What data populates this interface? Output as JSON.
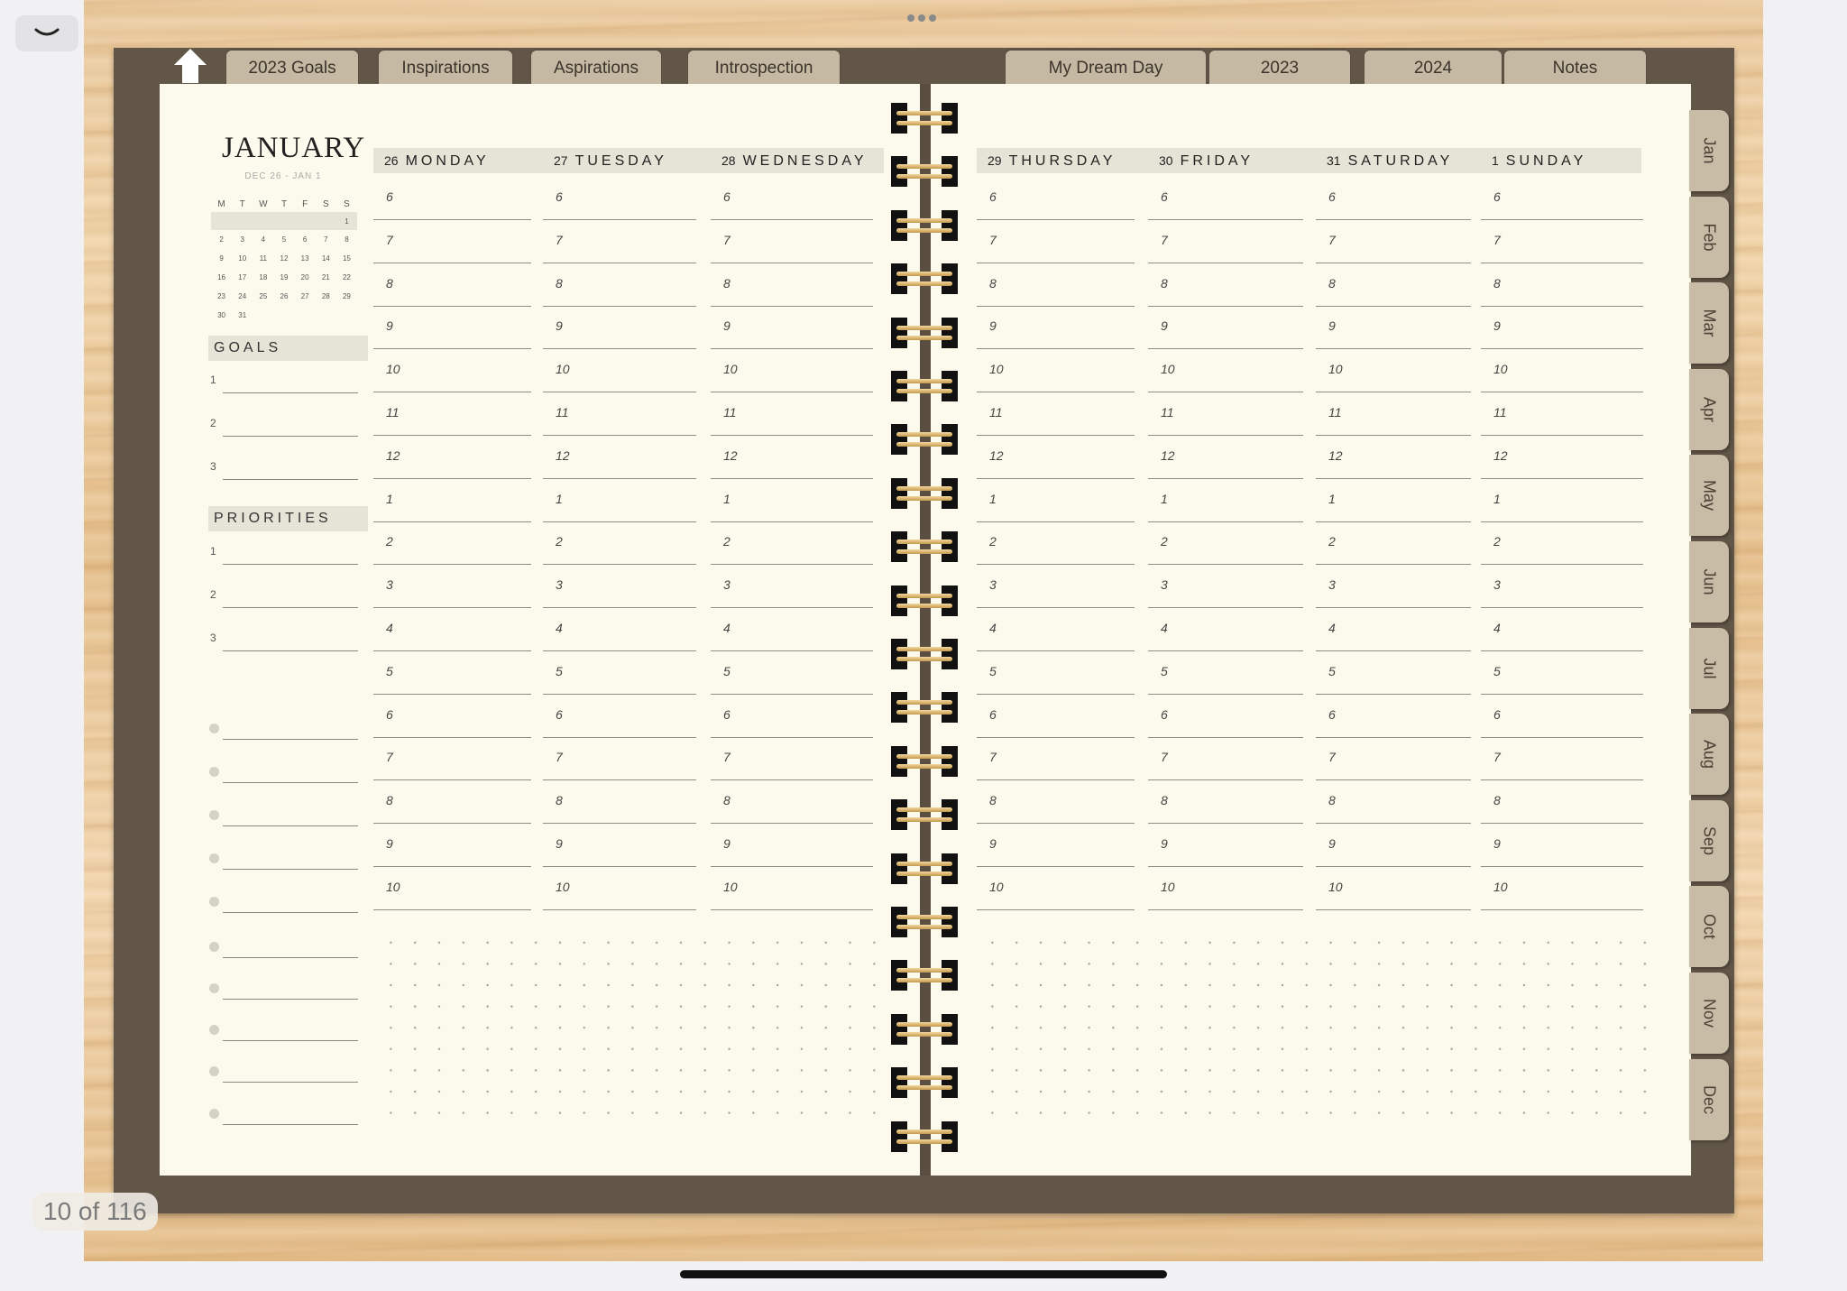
{
  "system": {
    "page_counter": "10 of 116",
    "collapse_icon": "chevron-down-icon"
  },
  "top_tabs_left": [
    "2023 Goals",
    "Inspirations",
    "Aspirations",
    "Introspection"
  ],
  "top_tabs_right": [
    "My Dream Day",
    "2023",
    "2024",
    "Notes"
  ],
  "month_tabs": [
    "Jan",
    "Feb",
    "Mar",
    "Apr",
    "May",
    "Jun",
    "Jul",
    "Aug",
    "Sep",
    "Oct",
    "Nov",
    "Dec"
  ],
  "sidebar": {
    "month": "JANUARY",
    "range": "DEC 26 - JAN 1",
    "mini_calendar": {
      "weekday_headers": [
        "M",
        "T",
        "W",
        "T",
        "F",
        "S",
        "S"
      ],
      "weeks": [
        [
          "",
          "",
          "",
          "",
          "",
          "",
          "1"
        ],
        [
          "2",
          "3",
          "4",
          "5",
          "6",
          "7",
          "8"
        ],
        [
          "9",
          "10",
          "11",
          "12",
          "13",
          "14",
          "15"
        ],
        [
          "16",
          "17",
          "18",
          "19",
          "20",
          "21",
          "22"
        ],
        [
          "23",
          "24",
          "25",
          "26",
          "27",
          "28",
          "29"
        ],
        [
          "30",
          "31",
          "",
          "",
          "",
          "",
          ""
        ]
      ]
    },
    "goals_title": "GOALS",
    "goals": [
      "1",
      "2",
      "3"
    ],
    "priorities_title": "PRIORITIES",
    "priorities": [
      "1",
      "2",
      "3"
    ]
  },
  "days": [
    {
      "num": "26",
      "name": "MONDAY"
    },
    {
      "num": "27",
      "name": "TUESDAY"
    },
    {
      "num": "28",
      "name": "WEDNESDAY"
    },
    {
      "num": "29",
      "name": "THURSDAY"
    },
    {
      "num": "30",
      "name": "FRIDAY"
    },
    {
      "num": "31",
      "name": "SATURDAY"
    },
    {
      "num": "1",
      "name": "SUNDAY"
    }
  ],
  "hours": [
    "6",
    "7",
    "8",
    "9",
    "10",
    "11",
    "12",
    "1",
    "2",
    "3",
    "4",
    "5",
    "6",
    "7",
    "8",
    "9",
    "10"
  ]
}
